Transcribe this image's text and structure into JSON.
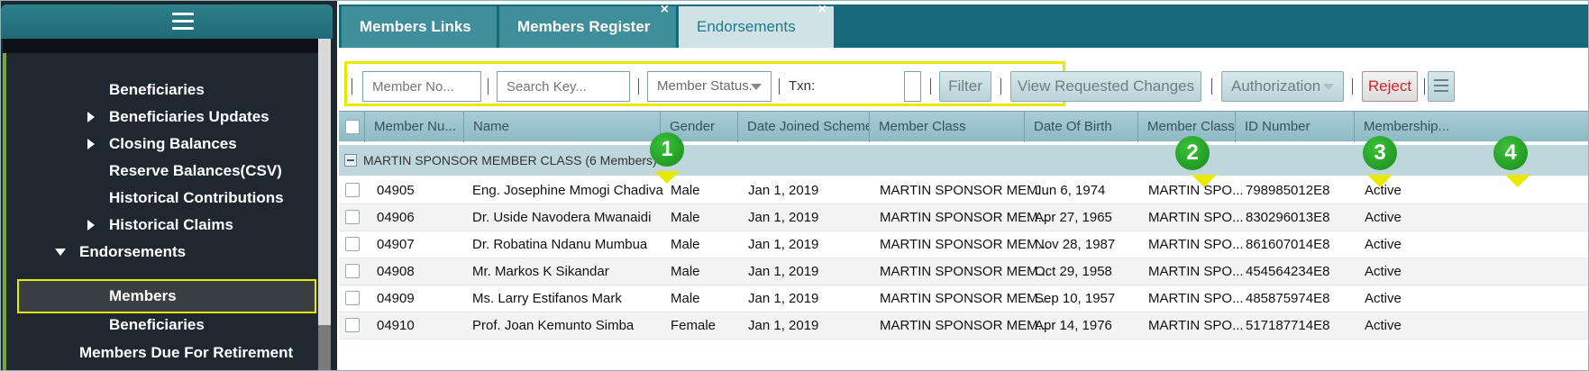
{
  "sidebar": {
    "items": [
      {
        "label": "Beneficiaries",
        "arrow": "none"
      },
      {
        "label": "Beneficiaries Updates",
        "arrow": "right"
      },
      {
        "label": "Closing Balances",
        "arrow": "right"
      },
      {
        "label": "Reserve Balances(CSV)",
        "arrow": "none"
      },
      {
        "label": "Historical Contributions",
        "arrow": "none"
      },
      {
        "label": "Historical Claims",
        "arrow": "right"
      },
      {
        "label": "Endorsements",
        "arrow": "down"
      },
      {
        "label": "Members",
        "arrow": "none",
        "selected": true
      },
      {
        "label": "Beneficiaries",
        "arrow": "none"
      },
      {
        "label": "Members Due For Retirement",
        "arrow": "none"
      }
    ]
  },
  "tabs": [
    {
      "label": "Members Links"
    },
    {
      "label": "Members Register",
      "close": "×"
    },
    {
      "label": "Endorsements",
      "close": "×",
      "active": true
    }
  ],
  "toolbar": {
    "member_no_placeholder": "Member No...",
    "search_key_placeholder": "Search Key...",
    "member_status_label": "Member Status.",
    "txn_label": "Txn:",
    "filter_label": "Filter",
    "view_changes_label": "View Requested Changes",
    "authorization_label": "Authorization",
    "reject_label": "Reject"
  },
  "grid": {
    "columns": [
      "Member Nu...",
      "Name",
      "Gender",
      "Date Joined Scheme",
      "Member Class",
      "Date Of Birth",
      "Member Class",
      "ID Number",
      "Membership..."
    ],
    "group_label": "MARTIN SPONSOR MEMBER CLASS (6 Members)",
    "rows": [
      [
        "04905",
        "Eng. Josephine Mmogi Chadiva",
        "Male",
        "Jan 1, 2019",
        "MARTIN SPONSOR MEM...",
        "Jun 6, 1974",
        "MARTIN SPO...",
        "798985012E8",
        "Active"
      ],
      [
        "04906",
        "Dr. Uside Navodera Mwanaidi",
        "Male",
        "Jan 1, 2019",
        "MARTIN SPONSOR MEM...",
        "Apr 27, 1965",
        "MARTIN SPO...",
        "830296013E8",
        "Active"
      ],
      [
        "04907",
        "Dr. Robatina Ndanu Mumbua",
        "Male",
        "Jan 1, 2019",
        "MARTIN SPONSOR MEM...",
        "Nov 28, 1987",
        "MARTIN SPO...",
        "861607014E8",
        "Active"
      ],
      [
        "04908",
        "Mr. Markos K Sikandar",
        "Male",
        "Jan 1, 2019",
        "MARTIN SPONSOR MEM...",
        "Oct 29, 1958",
        "MARTIN SPO...",
        "454564234E8",
        "Active"
      ],
      [
        "04909",
        "Ms. Larry Estifanos Mark",
        "Male",
        "Jan 1, 2019",
        "MARTIN SPONSOR MEM...",
        "Sep 10, 1957",
        "MARTIN SPO...",
        "485875974E8",
        "Active"
      ],
      [
        "04910",
        "Prof. Joan Kemunto Simba",
        "Female",
        "Jan 1, 2019",
        "MARTIN SPONSOR MEM...",
        "Apr 14, 1976",
        "MARTIN SPO...",
        "517187714E8",
        "Active"
      ]
    ]
  },
  "callouts": [
    "1",
    "2",
    "3",
    "4"
  ],
  "colors": {
    "sidebar_bg": "#1f2730",
    "tabbar_bg": "#17687a",
    "highlight": "#e8e800",
    "callout_green": "#178a17",
    "reject_red": "#e01f1f"
  }
}
